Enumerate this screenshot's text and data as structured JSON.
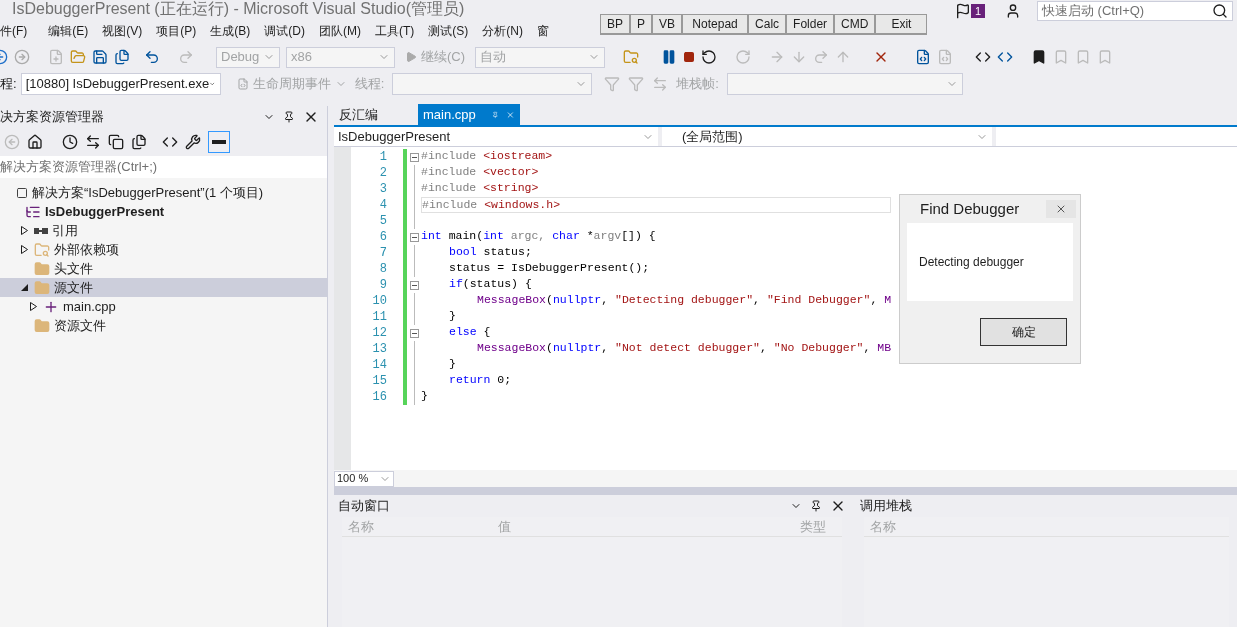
{
  "window": {
    "title": "IsDebuggerPresent (正在运行) - Microsoft Visual Studio(管理员)"
  },
  "menu": [
    "件(F)",
    "编辑(E)",
    "视图(V)",
    "项目(P)",
    "生成(B)",
    "调试(D)",
    "团队(M)",
    "工具(T)",
    "测试(S)",
    "分析(N)",
    "窗"
  ],
  "notification_badge": "1",
  "quick_launch": {
    "placeholder": "快速启动 (Ctrl+Q)"
  },
  "toolbar": {
    "configuration": "Debug",
    "platform": "x86",
    "continue": "继续(C)",
    "auto": "自动"
  },
  "debug_toolbar": {
    "process_label": "程:",
    "process": "[10880] IsDebuggerPresent.exe",
    "lifecycle": "生命周期事件",
    "thread_label": "线程:",
    "stack_frame_label": "堆栈帧:"
  },
  "solution_explorer": {
    "title": "决方案资源管理器",
    "search": {
      "placeholder": "解决方案资源管理器(Ctrl+;)"
    },
    "tree": [
      {
        "label": "解决方案“IsDebuggerPresent”(1 个项目)",
        "kind": "solution",
        "selected": false,
        "children": [
          {
            "label": "IsDebuggerPresent",
            "kind": "project",
            "selected": false,
            "children": [
              {
                "label": "引用",
                "kind": "references",
                "expanded": false,
                "selected": false
              },
              {
                "label": "外部依赖项",
                "kind": "dependencies",
                "expanded": false,
                "selected": false
              },
              {
                "label": "头文件",
                "kind": "folder",
                "selected": false
              },
              {
                "label": "源文件",
                "kind": "folder",
                "expanded": true,
                "selected": true,
                "children": [
                  {
                    "label": "main.cpp",
                    "kind": "file",
                    "expanded": false,
                    "selected": false
                  }
                ]
              },
              {
                "label": "资源文件",
                "kind": "folder",
                "selected": false
              }
            ]
          }
        ]
      }
    ]
  },
  "editor": {
    "tabs": [
      {
        "label": "反汇编",
        "selected": false
      },
      {
        "label": "main.cpp",
        "selected": true
      }
    ],
    "nav": [
      "IsDebuggerPresent",
      "(全局范围)"
    ],
    "lines": [
      {
        "number": "1",
        "fold": true,
        "current": false,
        "body": false,
        "branch": false,
        "tokens": [
          {
            "kind": "pre",
            "text": "#include"
          },
          {
            "kind": "inc",
            "text": "<iostream>"
          }
        ]
      },
      {
        "number": "2",
        "fold": false,
        "current": false,
        "body": false,
        "branch": false,
        "tokens": [
          {
            "kind": "pre",
            "text": "#include"
          },
          {
            "kind": "inc",
            "text": "<vector>"
          }
        ]
      },
      {
        "number": "3",
        "fold": false,
        "current": false,
        "body": false,
        "branch": false,
        "tokens": [
          {
            "kind": "pre",
            "text": "#include"
          },
          {
            "kind": "inc",
            "text": "<string>"
          }
        ]
      },
      {
        "number": "4",
        "fold": false,
        "current": true,
        "body": false,
        "branch": false,
        "tokens": [
          {
            "kind": "pre",
            "text": "#include"
          },
          {
            "kind": "inc",
            "text": "<windows.h>"
          }
        ]
      },
      {
        "number": "5",
        "fold": false,
        "current": false
      },
      {
        "number": "6",
        "fold": true,
        "current": false,
        "body": false,
        "branch": false,
        "tokens": [
          {
            "kind": "kw",
            "text": "int"
          },
          {
            "kind": "plain",
            "text": "main("
          },
          {
            "kind": "kw",
            "text": "int"
          },
          {
            "kind": "param",
            "text": "argc,"
          },
          {
            "kind": "kw",
            "text": "char"
          },
          {
            "kind": "plain",
            "text": "*"
          },
          {
            "kind": "param",
            "text": "argv"
          },
          {
            "kind": "plain",
            "text": "[]) {"
          }
        ]
      },
      {
        "number": "7",
        "fold": false,
        "current": false,
        "body": true,
        "branch": false,
        "tokens": [
          {
            "kind": "kw",
            "text": "bool"
          },
          {
            "kind": "plain",
            "text": "status;"
          }
        ]
      },
      {
        "number": "8",
        "fold": false,
        "current": false,
        "body": true,
        "branch": false,
        "tokens": [
          {
            "kind": "plain",
            "text": "status = IsDebuggerPresent();"
          }
        ]
      },
      {
        "number": "9",
        "fold": true,
        "current": false,
        "body": true,
        "branch": false,
        "tokens": [
          {
            "kind": "kw",
            "text": "if"
          },
          {
            "kind": "plain",
            "text": "(status) {"
          }
        ]
      },
      {
        "number": "10",
        "fold": false,
        "current": false,
        "body": true,
        "branch": true,
        "tokens": [
          {
            "kind": "fn",
            "text": "MessageBox"
          },
          {
            "kind": "plain",
            "text": "("
          },
          {
            "kind": "kw",
            "text": "nullptr"
          },
          {
            "kind": "plain",
            "text": ","
          },
          {
            "kind": "str",
            "text": "\"Detecting debugger\""
          },
          {
            "kind": "plain",
            "text": ","
          },
          {
            "kind": "str",
            "text": "\"Find Debugger\""
          },
          {
            "kind": "plain",
            "text": ","
          },
          {
            "kind": "fn",
            "text": "M"
          }
        ]
      },
      {
        "number": "11",
        "fold": false,
        "current": false,
        "body": true,
        "branch": false,
        "tokens": [
          {
            "kind": "plain",
            "text": "}"
          }
        ]
      },
      {
        "number": "12",
        "fold": true,
        "current": false,
        "body": true,
        "branch": false,
        "tokens": [
          {
            "kind": "kw",
            "text": "else"
          },
          {
            "kind": "plain",
            "text": "{"
          }
        ]
      },
      {
        "number": "13",
        "fold": false,
        "current": false,
        "body": true,
        "branch": true,
        "tokens": [
          {
            "kind": "fn",
            "text": "MessageBox"
          },
          {
            "kind": "plain",
            "text": "("
          },
          {
            "kind": "kw",
            "text": "nullptr"
          },
          {
            "kind": "plain",
            "text": ","
          },
          {
            "kind": "str",
            "text": "\"Not detect debugger\""
          },
          {
            "kind": "plain",
            "text": ","
          },
          {
            "kind": "str",
            "text": "\"No Debugger\""
          },
          {
            "kind": "plain",
            "text": ","
          },
          {
            "kind": "fn",
            "text": "MB"
          }
        ]
      },
      {
        "number": "14",
        "fold": false,
        "current": false,
        "body": true,
        "branch": false,
        "tokens": [
          {
            "kind": "plain",
            "text": "}"
          }
        ]
      },
      {
        "number": "15",
        "fold": false,
        "current": false,
        "body": true,
        "branch": false,
        "tokens": [
          {
            "kind": "kw",
            "text": "return"
          },
          {
            "kind": "plain",
            "text": "0;"
          }
        ]
      },
      {
        "number": "16",
        "fold": false,
        "current": false,
        "body": false,
        "branch": false,
        "tokens": [
          {
            "kind": "plain",
            "text": "}"
          }
        ]
      }
    ],
    "zoom": "100 %"
  },
  "autos": {
    "title": "自动窗口",
    "columns": [
      "名称",
      "值",
      "类型"
    ]
  },
  "call_stack": {
    "title": "调用堆栈",
    "columns": [
      "名称"
    ]
  },
  "float_bar": {
    "buttons": [
      "BP",
      "P",
      "VB",
      "Notepad",
      "Calc",
      "Folder",
      "CMD",
      "Exit"
    ]
  },
  "dialog": {
    "title": "Find Debugger",
    "message": "Detecting debugger",
    "button": "确定"
  }
}
